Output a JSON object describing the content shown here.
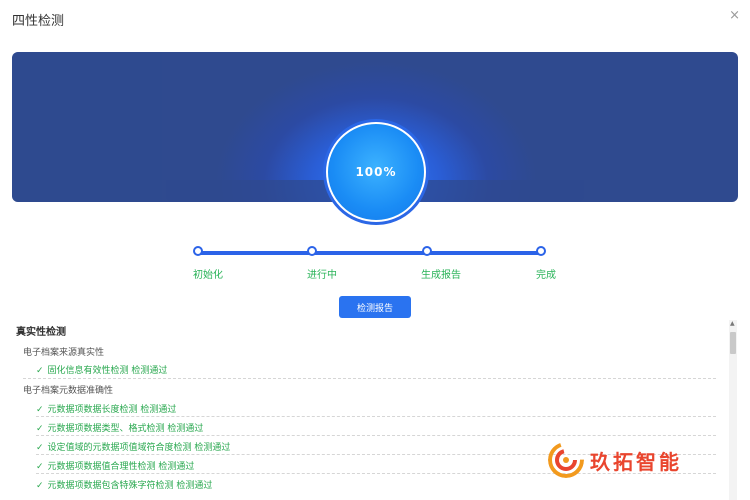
{
  "dialog": {
    "title": "四性检测",
    "close": "×"
  },
  "progress": {
    "label": "100%",
    "value": 100
  },
  "steps": [
    "初始化",
    "进行中",
    "生成报告",
    "完成"
  ],
  "report_button": "检测报告",
  "section": {
    "title": "真实性检测",
    "groups": [
      {
        "name": "电子档案来源真实性",
        "items": [
          "固化信息有效性检测 检测通过"
        ]
      },
      {
        "name": "电子档案元数据准确性",
        "items": [
          "元数据项数据长度检测 检测通过",
          "元数据项数据类型、格式检测 检测通过",
          "设定值域的元数据项值域符合度检测 检测通过",
          "元数据项数据值合理性检测 检测通过",
          "元数据项数据包含特殊字符检测 检测通过"
        ]
      }
    ]
  },
  "check_icon": "✓",
  "logo": {
    "text": "玖拓智能"
  },
  "colors": {
    "accent": "#2a73f0",
    "pass": "#29a84f",
    "banner": "#2f4a8f",
    "logo": "#e9452e"
  }
}
